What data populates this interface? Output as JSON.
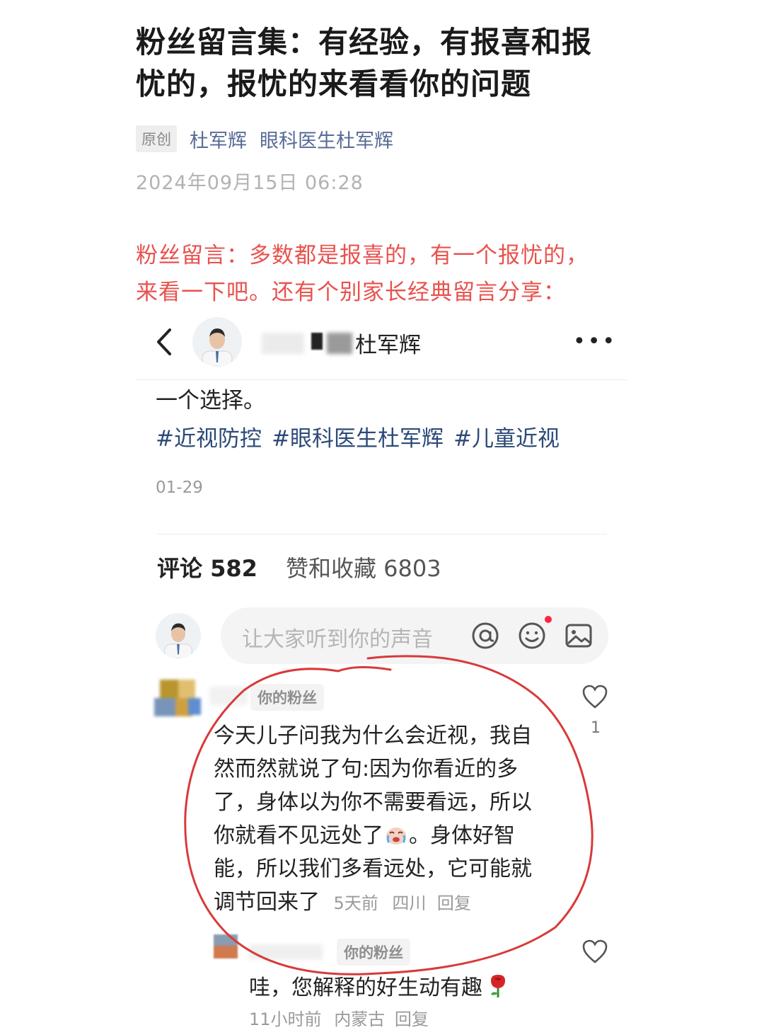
{
  "article": {
    "title_line1": "粉丝留言集：有经验，有报喜和报",
    "title_line2": "忧的，报忧的来看看你的问题",
    "original_tag": "原创",
    "author": "杜军辉",
    "account": "眼科医生杜军辉",
    "date": "2024年09月15日 06:28",
    "lead_line1": "粉丝留言：多数都是报喜的，有一个报忧的，",
    "lead_line2": "来看一下吧。还有个别家长经典留言分享："
  },
  "embedded_post": {
    "username": "杜军辉",
    "more_label": "•••",
    "text": "一个选择。",
    "hashtags": [
      "#近视防控",
      "#眼科医生杜军辉",
      "#儿童近视"
    ],
    "date": "01-29"
  },
  "stats": {
    "comments_label": "评论 582",
    "likes_label": "赞和收藏 6803"
  },
  "comment_input": {
    "placeholder": "让大家听到你的声音",
    "at_icon": "at-icon",
    "emoji_icon": "emoji-icon",
    "image_icon": "image-icon",
    "accent": "#ff2442"
  },
  "comments": [
    {
      "badge": "你的粉丝",
      "lines": [
        "今天儿子问我为什么会近视，我自",
        "然而然就说了句:因为你看近的多",
        "了，身体以为你不需要看远，所以",
        "你就看不见远处了",
        "。身体好智",
        "能，所以我们多看远处，它可能就",
        "调节回来了"
      ],
      "time": "5天前",
      "location": "四川",
      "reply_label": "回复",
      "likes": "1"
    }
  ],
  "reply": {
    "badge": "你的粉丝",
    "text": "哇，您解释的好生动有趣",
    "time": "11小时前",
    "location": "内蒙古",
    "reply_label": "回复"
  },
  "annotation_color": "#d83a3a"
}
